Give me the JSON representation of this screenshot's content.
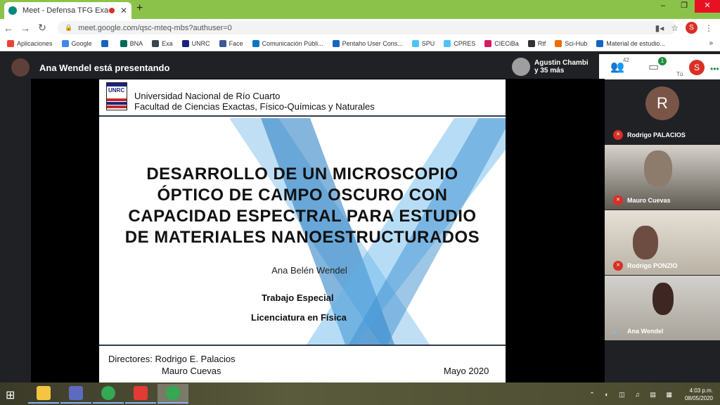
{
  "browser": {
    "tab_title": "Meet - Defensa TFG Exactas",
    "tab_close": "✕",
    "new_tab": "+",
    "window_controls": [
      "–",
      "❐",
      "✕"
    ],
    "url": "meet.google.com/qsc-mteq-mbs?authuser=0",
    "profile_initial": "S",
    "bookmarks": [
      {
        "label": "Aplicaciones",
        "color": "#ea4335"
      },
      {
        "label": "Google",
        "color": "#4285f4"
      },
      {
        "label": "",
        "color": "#1565c0"
      },
      {
        "label": "BNA",
        "color": "#00695c"
      },
      {
        "label": "Exa",
        "color": "#37474f"
      },
      {
        "label": "UNRC",
        "color": "#1a237e"
      },
      {
        "label": "Face",
        "color": "#3b5998"
      },
      {
        "label": "Comunicación Públi...",
        "color": "#0277bd"
      },
      {
        "label": "Pentaho User Cons...",
        "color": "#1565c0"
      },
      {
        "label": "SPU",
        "color": "#4fc3f7"
      },
      {
        "label": "CPRES",
        "color": "#4fc3f7"
      },
      {
        "label": "CIECiBa",
        "color": "#d81b60"
      },
      {
        "label": "Rtf",
        "color": "#333333"
      },
      {
        "label": "Sci-Hub",
        "color": "#ef6c00"
      },
      {
        "label": "Material de estudio...",
        "color": "#1565c0"
      }
    ],
    "bookmarks_more": "»"
  },
  "meet": {
    "presenter_text": "Ana Wendel está presentando",
    "others_line1": "Agustin Chambi",
    "others_line2": "y 35 más",
    "participants_count": "42",
    "chat_badge": "1",
    "self_label": "Tú",
    "self_initial": "S",
    "participants": [
      {
        "name": "Rodrigo PALACIOS",
        "initial": "R",
        "muted": true,
        "bg": "#202124"
      },
      {
        "name": "Mauro Cuevas",
        "muted": true,
        "bg": "#6d6a63"
      },
      {
        "name": "Rodrigo PONZIO",
        "muted": true,
        "bg": "#c9c4ba"
      },
      {
        "name": "Ana Wendel",
        "muted": false,
        "bg": "#cfcac2"
      }
    ]
  },
  "slide": {
    "logo_text": "UNRC",
    "header_line1": "Universidad Nacional de Río Cuarto",
    "header_line2": "Facultad de Ciencias Exactas, Físico-Químicas y Naturales",
    "title_lines": [
      "DESARROLLO DE UN MICROSCOPIO",
      "ÓPTICO DE CAMPO OSCURO CON",
      "CAPACIDAD ESPECTRAL PARA ESTUDIO",
      "DE MATERIALES NANOESTRUCTURADOS"
    ],
    "author": "Ana Belén Wendel",
    "subtitle_1": "Trabajo Especial",
    "subtitle_2": "Licenciatura en Física",
    "directors_1": "Directores: Rodrigo E. Palacios",
    "directors_2": "Mauro Cuevas",
    "date": "Mayo 2020"
  },
  "taskbar": {
    "apps": [
      {
        "name": "file-explorer",
        "color": "#f4c542"
      },
      {
        "name": "calendar-app",
        "color": "#5c6bc0"
      },
      {
        "name": "chrome",
        "color": "#34a853"
      },
      {
        "name": "acrobat",
        "color": "#e53935"
      },
      {
        "name": "chrome-active",
        "color": "#34a853"
      }
    ],
    "tray_icons": "⌃ ◐ ◫ ♫ ▤ ▦",
    "time": "4:03 p.m.",
    "date": "08/05/2020"
  }
}
